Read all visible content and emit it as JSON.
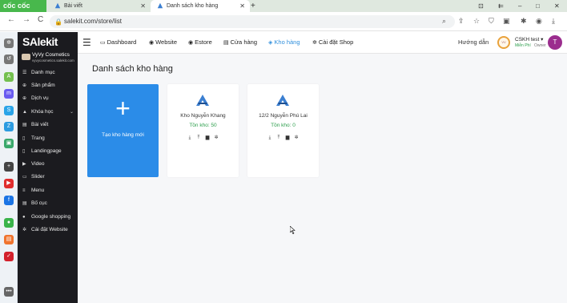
{
  "browser": {
    "brand": "cốc cốc",
    "tabs": [
      {
        "label": "Bài viết",
        "active": false
      },
      {
        "label": "Danh sách kho hàng",
        "active": true
      }
    ],
    "new_tab": "+",
    "url": "salekit.com/store/list",
    "nav": {
      "back": "←",
      "forward": "→",
      "reload": "C"
    },
    "window": {
      "min": "–",
      "max": "□",
      "close": "✕"
    }
  },
  "sidebar": {
    "logo": "SAlekit",
    "shop_name": "VyVy Cosmetics",
    "shop_url": "vyvycosmetics.salekit.com",
    "items": [
      {
        "label": "Danh mục",
        "icon": "list-icon"
      },
      {
        "label": "Sản phẩm",
        "icon": "product-icon"
      },
      {
        "label": "Dịch vụ",
        "icon": "service-icon"
      },
      {
        "label": "Khóa học",
        "icon": "course-icon"
      },
      {
        "label": "Bài viết",
        "icon": "article-icon"
      },
      {
        "label": "Trang",
        "icon": "page-icon"
      },
      {
        "label": "Landingpage",
        "icon": "landing-icon"
      },
      {
        "label": "Video",
        "icon": "video-icon"
      },
      {
        "label": "Slider",
        "icon": "slider-icon"
      },
      {
        "label": "Menu",
        "icon": "menu-icon"
      },
      {
        "label": "Bố cục",
        "icon": "layout-icon"
      },
      {
        "label": "Google shopping",
        "icon": "google-icon"
      },
      {
        "label": "Cài đặt Website",
        "icon": "settings-icon"
      }
    ]
  },
  "topnav": {
    "links": [
      {
        "label": "Dashboard",
        "icon": "▭"
      },
      {
        "label": "Website",
        "icon": "◉"
      },
      {
        "label": "Estore",
        "icon": "◉"
      },
      {
        "label": "Cửa hàng",
        "icon": "▤"
      },
      {
        "label": "Kho hàng",
        "icon": "◈",
        "active": true
      },
      {
        "label": "Cài đặt Shop",
        "icon": "✲"
      }
    ],
    "guide": "Hướng dẫn",
    "user_name": "CSKH test",
    "user_plan": "Miễn Phí",
    "user_role": "Owner",
    "avatar_letter": "T"
  },
  "main": {
    "title": "Danh sách kho hàng",
    "new_card_label": "Tạo kho hàng mới",
    "warehouses": [
      {
        "name": "Kho Nguyễn Khang",
        "stock": "Tồn kho: 50"
      },
      {
        "name": "12/2 Nguyễn Phú Lai",
        "stock": "Tồn kho: 0"
      }
    ]
  },
  "colors": {
    "accent": "#2b8ce8",
    "sidebar_bg": "#1b1b1f",
    "stock_green": "#2a9d4a",
    "avatar": "#9b2d8e"
  }
}
